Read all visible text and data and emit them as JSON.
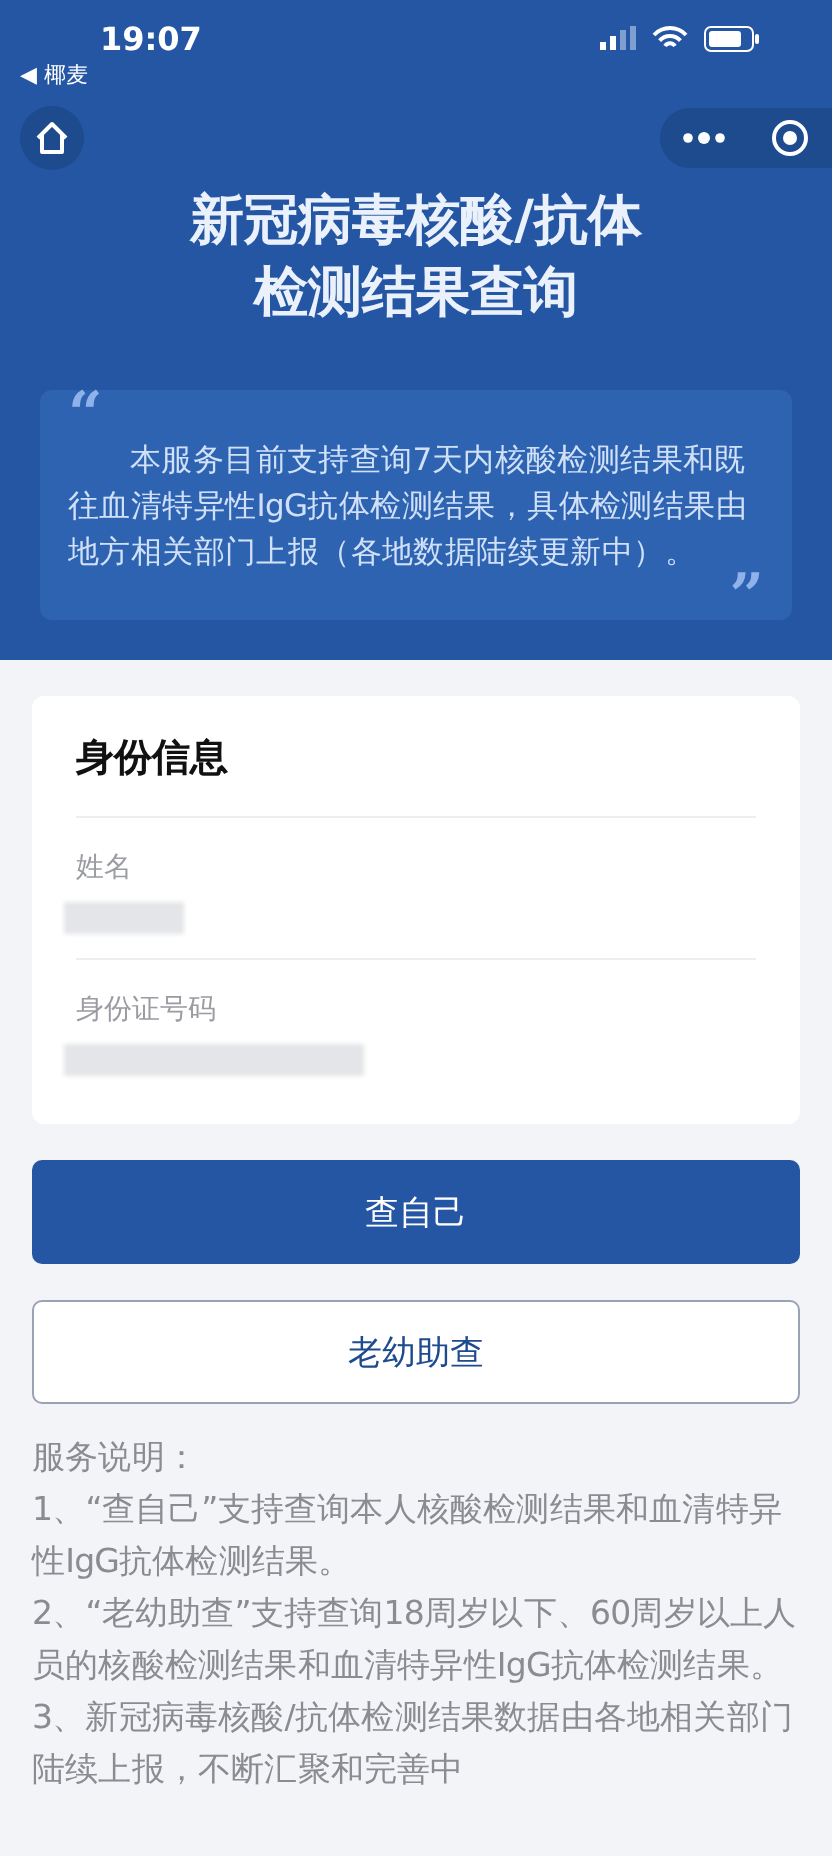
{
  "status_bar": {
    "time": "19:07",
    "back_label": "◀ 椰麦"
  },
  "header": {
    "title_lines": [
      "新冠病毒核酸/抗体",
      "检测结果查询"
    ],
    "intro": "本服务目前支持查询7天内核酸检测结果和既往血清特异性IgG抗体检测结果，具体检测结果由地方相关部门上报（各地数据陆续更新中）。",
    "open_quote": "“",
    "close_quote": "”"
  },
  "identity_card": {
    "title": "身份信息",
    "fields": [
      {
        "label": "姓名",
        "redacted": true
      },
      {
        "label": "身份证号码",
        "redacted": true
      }
    ]
  },
  "buttons": [
    {
      "label": "查自己",
      "kind": "primary"
    },
    {
      "label": "老幼助查",
      "kind": "outline"
    }
  ],
  "notes": {
    "heading": "服务说明：",
    "items": [
      "1、“查自己”支持查询本人核酸检测结果和血清特异性IgG抗体检测结果。",
      "2、“老幼助查”支持查询18周岁以下、60周岁以上人员的核酸检测结果和血清特异性IgG抗体检测结果。",
      "3、新冠病毒核酸/抗体检测结果数据由各地相关部门陆续上报，不断汇聚和完善中"
    ]
  }
}
